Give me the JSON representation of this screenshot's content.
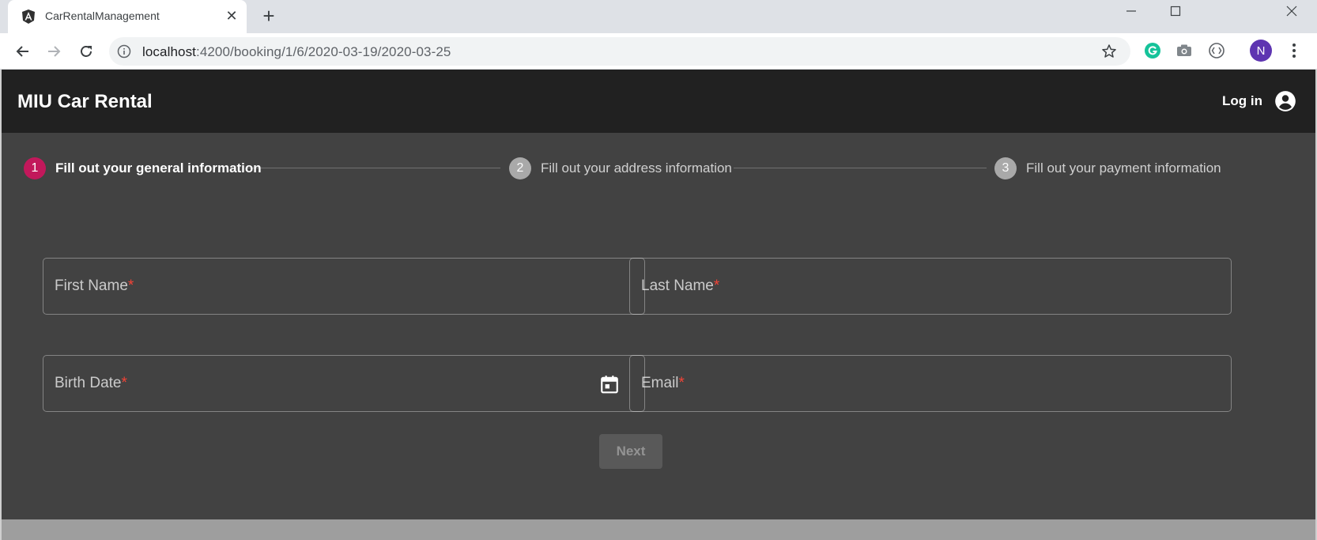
{
  "browser": {
    "tab_title": "CarRentalManagement",
    "close_tab_symbol": "✕",
    "new_tab_symbol": "+",
    "url_host": "localhost",
    "url_path": ":4200/booking/1/6/2020-03-19/2020-03-25",
    "profile_initial": "N",
    "icons": [
      "angular-favicon",
      "back-icon",
      "forward-icon",
      "reload-icon",
      "info-icon",
      "star-icon",
      "grammarly-icon",
      "camera-icon",
      "extension-icon",
      "kebab-menu-icon",
      "minimize-icon",
      "maximize-icon",
      "close-window-icon"
    ]
  },
  "app": {
    "brand": "MIU Car Rental",
    "login_label": "Log in",
    "accent_color": "#c2185b",
    "stepper": [
      {
        "number": "1",
        "label": "Fill out your general information",
        "active": true
      },
      {
        "number": "2",
        "label": "Fill out your address information",
        "active": false
      },
      {
        "number": "3",
        "label": "Fill out your payment information",
        "active": false
      }
    ],
    "form": {
      "first_name_label": "First Name",
      "last_name_label": "Last Name",
      "birth_date_label": "Birth Date",
      "email_label": "Email",
      "required_marker": "*",
      "next_label": "Next"
    }
  }
}
